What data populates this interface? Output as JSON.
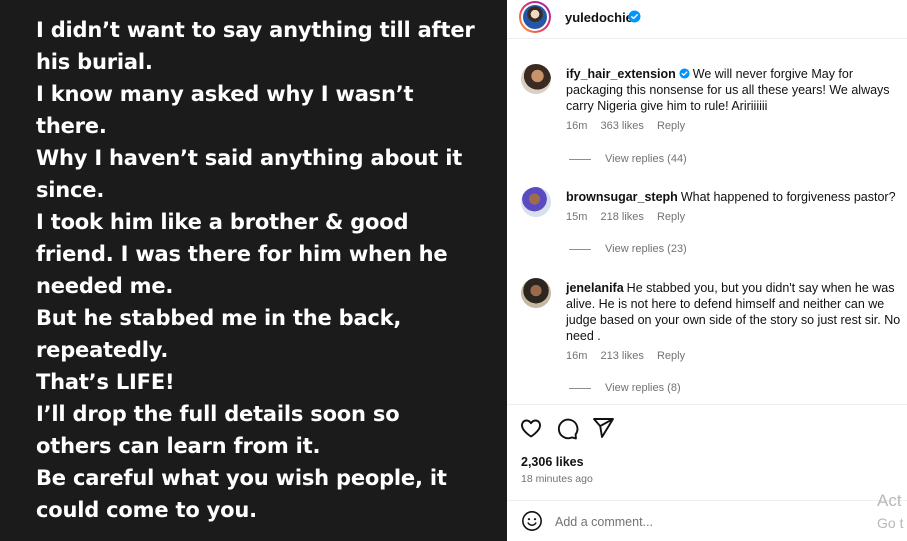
{
  "post": {
    "lines": [
      "I didn’t want to say anything till after",
      "his burial.",
      "I know many asked why I wasn’t",
      "there.",
      "Why I haven’t said anything about it",
      "since.",
      "I took him like a brother & good",
      "friend. I was there for him when he",
      "needed me.",
      "But he stabbed me in the back,",
      "repeatedly.",
      "That’s LIFE!",
      "I’ll drop the full details soon so",
      "others can learn from it.",
      "Be careful what you wish people, it",
      "could come to you."
    ]
  },
  "author": {
    "username": "yuledochie",
    "verified": true
  },
  "comments": [
    {
      "username": "ify_hair_extension",
      "verified": true,
      "text": "We will never forgive May for packaging this nonsense for us all these years! We always carry Nigeria give him to rule! Aririiiiii",
      "time": "16m",
      "likes": "363 likes",
      "reply": "Reply",
      "view_replies": "View replies (44)"
    },
    {
      "username": "brownsugar_steph",
      "verified": false,
      "text": "What happened to forgiveness pastor?",
      "time": "15m",
      "likes": "218 likes",
      "reply": "Reply",
      "view_replies": "View replies (23)"
    },
    {
      "username": "jenelanifa",
      "verified": false,
      "text": "He stabbed you, but you didn't say when he was alive. He is not here to defend himself and neither can we judge based on your own side of the story so just rest sir. No need .",
      "time": "16m",
      "likes": "213 likes",
      "reply": "Reply",
      "view_replies": "View replies (8)"
    }
  ],
  "actions": {
    "like_icon": "heart-icon",
    "comment_icon": "comment-icon",
    "share_icon": "share-icon"
  },
  "stats": {
    "likes": "2,306 likes",
    "time_ago": "18 minutes ago"
  },
  "composer": {
    "placeholder": "Add a comment..."
  },
  "watermark": {
    "line1": "Act",
    "line2": "Go t"
  },
  "colors": {
    "verified": "#0095f6",
    "muted": "#737373",
    "post_bg": "#1b1b1b"
  }
}
